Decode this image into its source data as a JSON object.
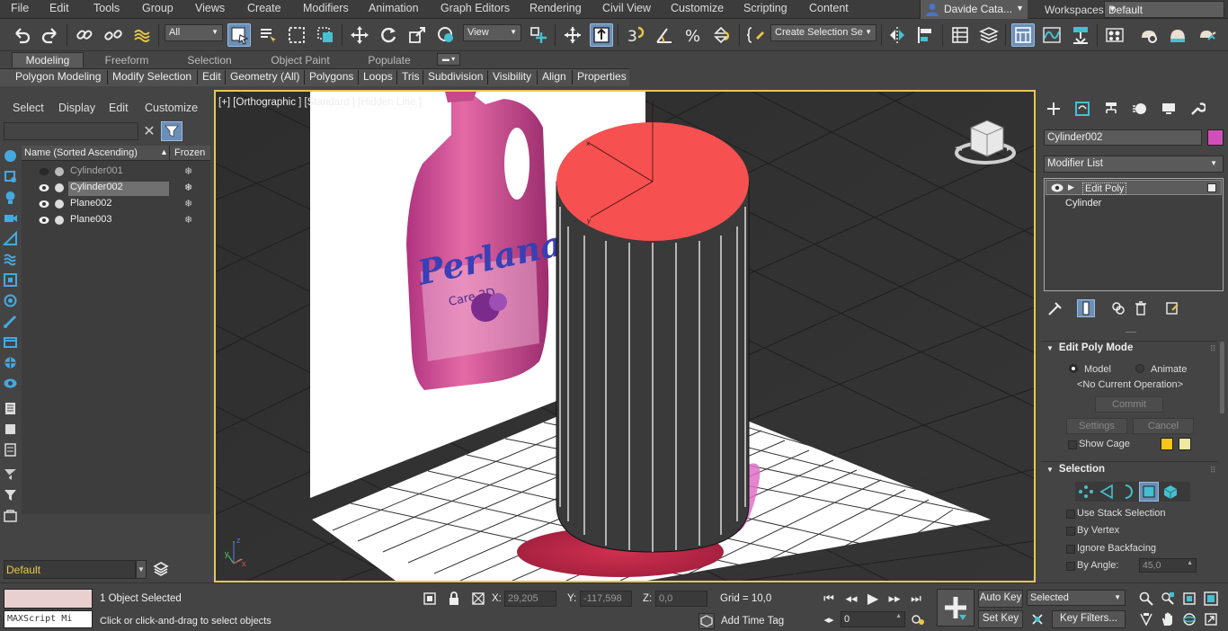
{
  "menu": [
    "File",
    "Edit",
    "Tools",
    "Group",
    "Views",
    "Create",
    "Modifiers",
    "Animation",
    "Graph Editors",
    "Rendering",
    "Civil View",
    "Customize",
    "Scripting",
    "Content"
  ],
  "user": {
    "name": "Davide Cata..."
  },
  "workspaces": {
    "label": "Workspaces:",
    "value": "Default"
  },
  "toolbar": {
    "selection_filter": "All",
    "reference_coord": "View",
    "named_selection": "Create Selection Se"
  },
  "ribbon": {
    "tabs": [
      "Modeling",
      "Freeform",
      "Selection",
      "Object Paint",
      "Populate"
    ],
    "active_tab": "Modeling",
    "subtabs": [
      "Polygon Modeling",
      "Modify Selection",
      "Edit",
      "Geometry (All)",
      "Polygons",
      "Loops",
      "Tris",
      "Subdivision",
      "Visibility",
      "Align",
      "Properties"
    ]
  },
  "explorer": {
    "tabs": [
      "Select",
      "Display",
      "Edit",
      "Customize"
    ],
    "search_value": "",
    "col_name": "Name (Sorted Ascending)",
    "col_frozen": "Frozen",
    "rows": [
      {
        "name": "Cylinder001",
        "visible": false,
        "selected": false
      },
      {
        "name": "Cylinder002",
        "visible": true,
        "selected": true
      },
      {
        "name": "Plane002",
        "visible": true,
        "selected": false
      },
      {
        "name": "Plane003",
        "visible": true,
        "selected": false
      }
    ],
    "frozen_glyph": "❄",
    "layer": "Default"
  },
  "viewport": {
    "label": "[+] [Orthographic ] [Standard ] [Hidden Line ]",
    "product_text": {
      "brand": "Perlana",
      "sub": "Care 3D"
    },
    "axis": {
      "x": "x",
      "y": "y",
      "z": "z"
    },
    "cylinder_top_color": "#f75050"
  },
  "command_panel": {
    "object_name": "Cylinder002",
    "object_color": "#d14fb9",
    "modifier_list": "Modifier List",
    "stack": [
      "Edit Poly",
      "Cylinder"
    ],
    "edit_poly_mode": {
      "title": "Edit Poly Mode",
      "model": "Model",
      "animate": "Animate",
      "current_op": "<No Current Operation>",
      "commit": "Commit",
      "settings": "Settings",
      "cancel": "Cancel",
      "show_cage": "Show Cage"
    },
    "selection": {
      "title": "Selection",
      "use_stack": "Use Stack Selection",
      "by_vertex": "By Vertex",
      "ignore_backfacing": "Ignore Backfacing",
      "by_angle": "By Angle:",
      "angle_value": "45,0"
    }
  },
  "status": {
    "maxscript": "MAXScript Mi",
    "selected_count": "1 Object Selected",
    "prompt": "Click or click-and-drag to select objects",
    "x_label": "X:",
    "x_value": "29,205",
    "y_label": "Y:",
    "y_value": "-117,598",
    "z_label": "Z:",
    "z_value": "0,0",
    "grid": "Grid = 10,0",
    "add_time_tag": "Add Time Tag",
    "frame": "0",
    "auto_key": "Auto Key",
    "set_key": "Set Key",
    "key_mode": "Selected",
    "key_filters": "Key Filters..."
  }
}
